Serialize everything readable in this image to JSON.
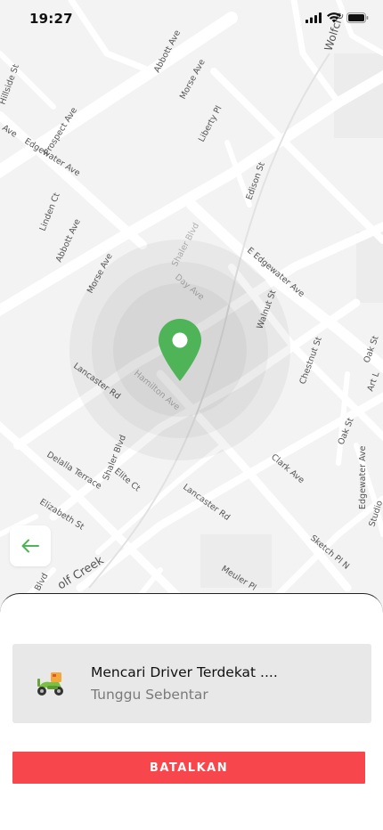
{
  "status_bar": {
    "time": "19:27",
    "icons": [
      "signal-icon",
      "wifi-icon",
      "battery-icon"
    ]
  },
  "map": {
    "street_labels": {
      "abbott_ave_top": "Abbott Ave",
      "morse_ave_top": "Morse Ave",
      "liberty_pl": "Liberty Pl",
      "prospect_ave": "Prospect Ave",
      "edgewater_ave_left": "Edgewater Ave",
      "linden_ct": "Linden Ct",
      "abbott_ave_mid": "Abbott Ave",
      "edison_st": "Edison St",
      "shaler_blvd_top": "Shaler Blvd",
      "morse_ave_mid": "Morse Ave",
      "e_edgewater_ave": "E Edgewater Ave",
      "day_ave": "Day Ave",
      "walnut_st": "Walnut St",
      "lancaster_rd_top": "Lancaster Rd",
      "hamilton_ave": "Hamilton Ave",
      "chestnut_st": "Chestnut St",
      "oak_st_right": "Oak St",
      "art_l": "Art L",
      "oak_st_mid": "Oak St",
      "edgewater_ave_right": "Edgewater Ave",
      "shaler_blvd_mid": "Shaler Blvd",
      "clark_ave": "Clark Ave",
      "delalla_terrace": "Delalla Terrace",
      "elite_ct": "Elite Ct",
      "elizabeth_st": "Elizabeth St",
      "lancaster_rd_bottom": "Lancaster Rd",
      "sketch_pl_n": "Sketch Pl N",
      "wolf_creek": "olf Creek",
      "meuler_pl": "Meuler Pl",
      "hillside": "Hillside St",
      "wolfcre": "Wolfcre",
      "studio": "Studio",
      "bird": "Blvd",
      "edgewater_top_left": "Ave"
    }
  },
  "back_button": {
    "icon": "arrow-left-icon"
  },
  "sheet": {
    "card": {
      "icon": "scooter-delivery-icon",
      "title": "Mencari Driver Terdekat ....",
      "subtitle": "Tunggu Sebentar"
    },
    "cancel_label": "BATALKAN"
  },
  "colors": {
    "pin": "#4fb357",
    "cancel_button": "#f8474c",
    "back_arrow": "#4fb357",
    "card_background": "#e8e8e8"
  }
}
